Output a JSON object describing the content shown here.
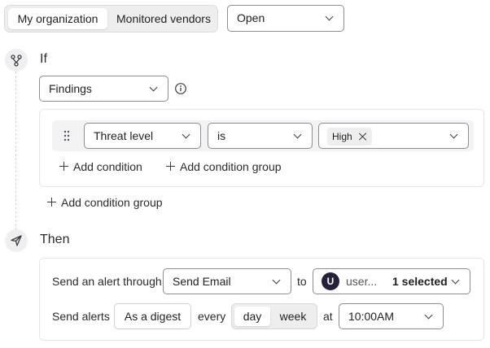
{
  "scope_tabs": {
    "active": "My organization",
    "inactive": "Monitored vendors"
  },
  "status_select": {
    "value": "Open"
  },
  "if_section": {
    "heading": "If",
    "source_select": {
      "value": "Findings"
    },
    "condition": {
      "field": "Threat level",
      "operator": "is",
      "tags": [
        "High"
      ]
    },
    "add_condition": "Add condition",
    "add_condition_group_inner": "Add condition group",
    "add_condition_group_outer": "Add condition group"
  },
  "then_section": {
    "heading": "Then",
    "send_alert_label": "Send an alert through",
    "channel_select": {
      "value": "Send Email"
    },
    "to_label": "to",
    "recipients": {
      "avatar_initial": "U",
      "name": "user...",
      "count": "1 selected"
    },
    "send_alerts_label": "Send alerts",
    "digest_button": "As a digest",
    "every_label": "every",
    "frequency": {
      "selected": "day",
      "other": "week"
    },
    "at_label": "at",
    "time_select": {
      "value": "10:00AM"
    }
  },
  "icons": {
    "if": "flow-branch-icon",
    "then": "send-icon",
    "info": "info-icon",
    "drag": "drag-handle-icon"
  }
}
